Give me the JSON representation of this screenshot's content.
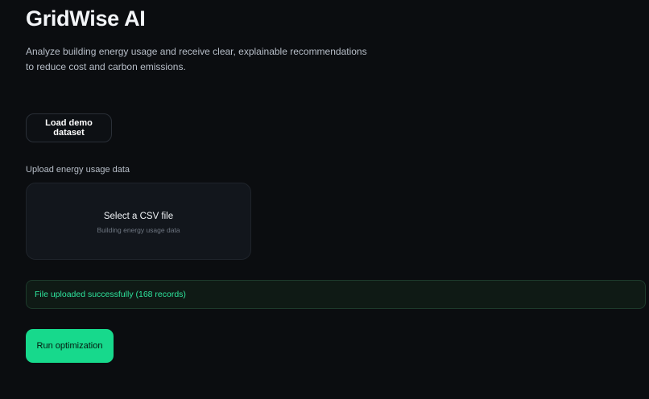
{
  "header": {
    "title": "GridWise AI",
    "subtitle": "Analyze building energy usage and receive clear, explainable recommendations to reduce cost and carbon emissions."
  },
  "actions": {
    "demo_label": "Load demo dataset",
    "run_label": "Run optimization"
  },
  "upload": {
    "label": "Upload energy usage data",
    "dropzone_title": "Select a CSV file",
    "dropzone_hint": "Building energy usage data"
  },
  "status": {
    "message": "File uploaded successfully (168 records)"
  },
  "colors": {
    "background": "#0b0d10",
    "accent": "#17d98c",
    "success_text": "#2ee59d"
  }
}
